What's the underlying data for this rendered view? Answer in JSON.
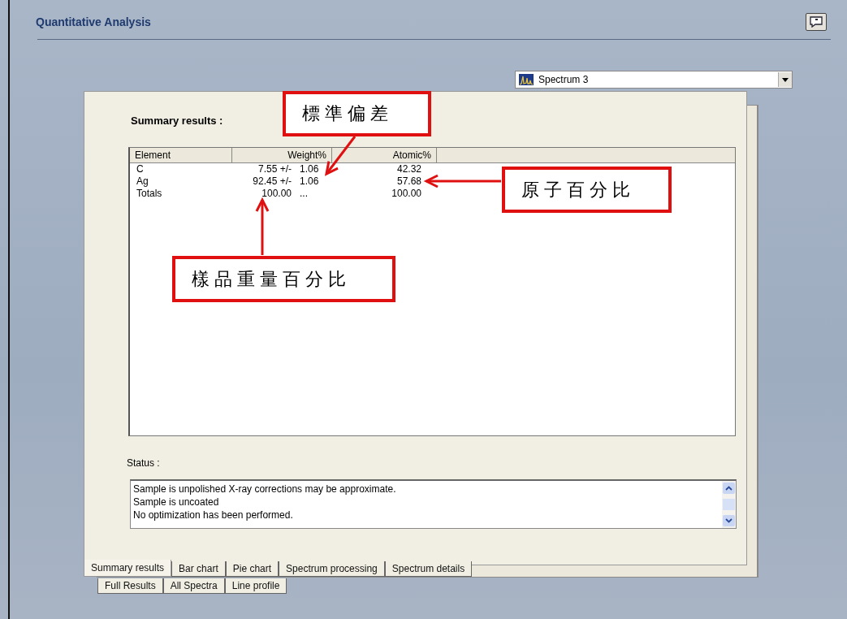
{
  "window": {
    "title": "Quantitative Analysis"
  },
  "spectrum_select": {
    "value": "Spectrum 3"
  },
  "summary": {
    "heading": "Summary results :",
    "columns": [
      "Element",
      "Weight%",
      "Atomic%"
    ],
    "rows": [
      {
        "element": "C",
        "weight": "7.55 +/-",
        "error": "1.06",
        "atomic": "42.32"
      },
      {
        "element": "Ag",
        "weight": "92.45 +/-",
        "error": "1.06",
        "atomic": "57.68"
      },
      {
        "element": "Totals",
        "weight": "100.00",
        "error": "...",
        "atomic": "100.00"
      }
    ]
  },
  "status": {
    "label": "Status :",
    "lines": [
      "Sample is unpolished X-ray corrections may be approximate.",
      "Sample is uncoated",
      "No optimization has been performed."
    ]
  },
  "tab_rows": [
    [
      {
        "label": "Summary results",
        "selected": true
      },
      {
        "label": "Bar chart",
        "selected": false
      },
      {
        "label": "Pie chart",
        "selected": false
      },
      {
        "label": "Spectrum processing",
        "selected": false
      },
      {
        "label": "Spectrum details",
        "selected": false
      }
    ],
    [
      {
        "label": "Full Results",
        "selected": false
      },
      {
        "label": "All Spectra",
        "selected": false
      },
      {
        "label": "Line profile",
        "selected": false
      }
    ]
  ],
  "annotations": [
    {
      "text": "標準偏差",
      "kind": "std"
    },
    {
      "text": "原子百分比",
      "kind": "atomic"
    },
    {
      "text": "樣品重量百分比",
      "kind": "weight"
    }
  ]
}
